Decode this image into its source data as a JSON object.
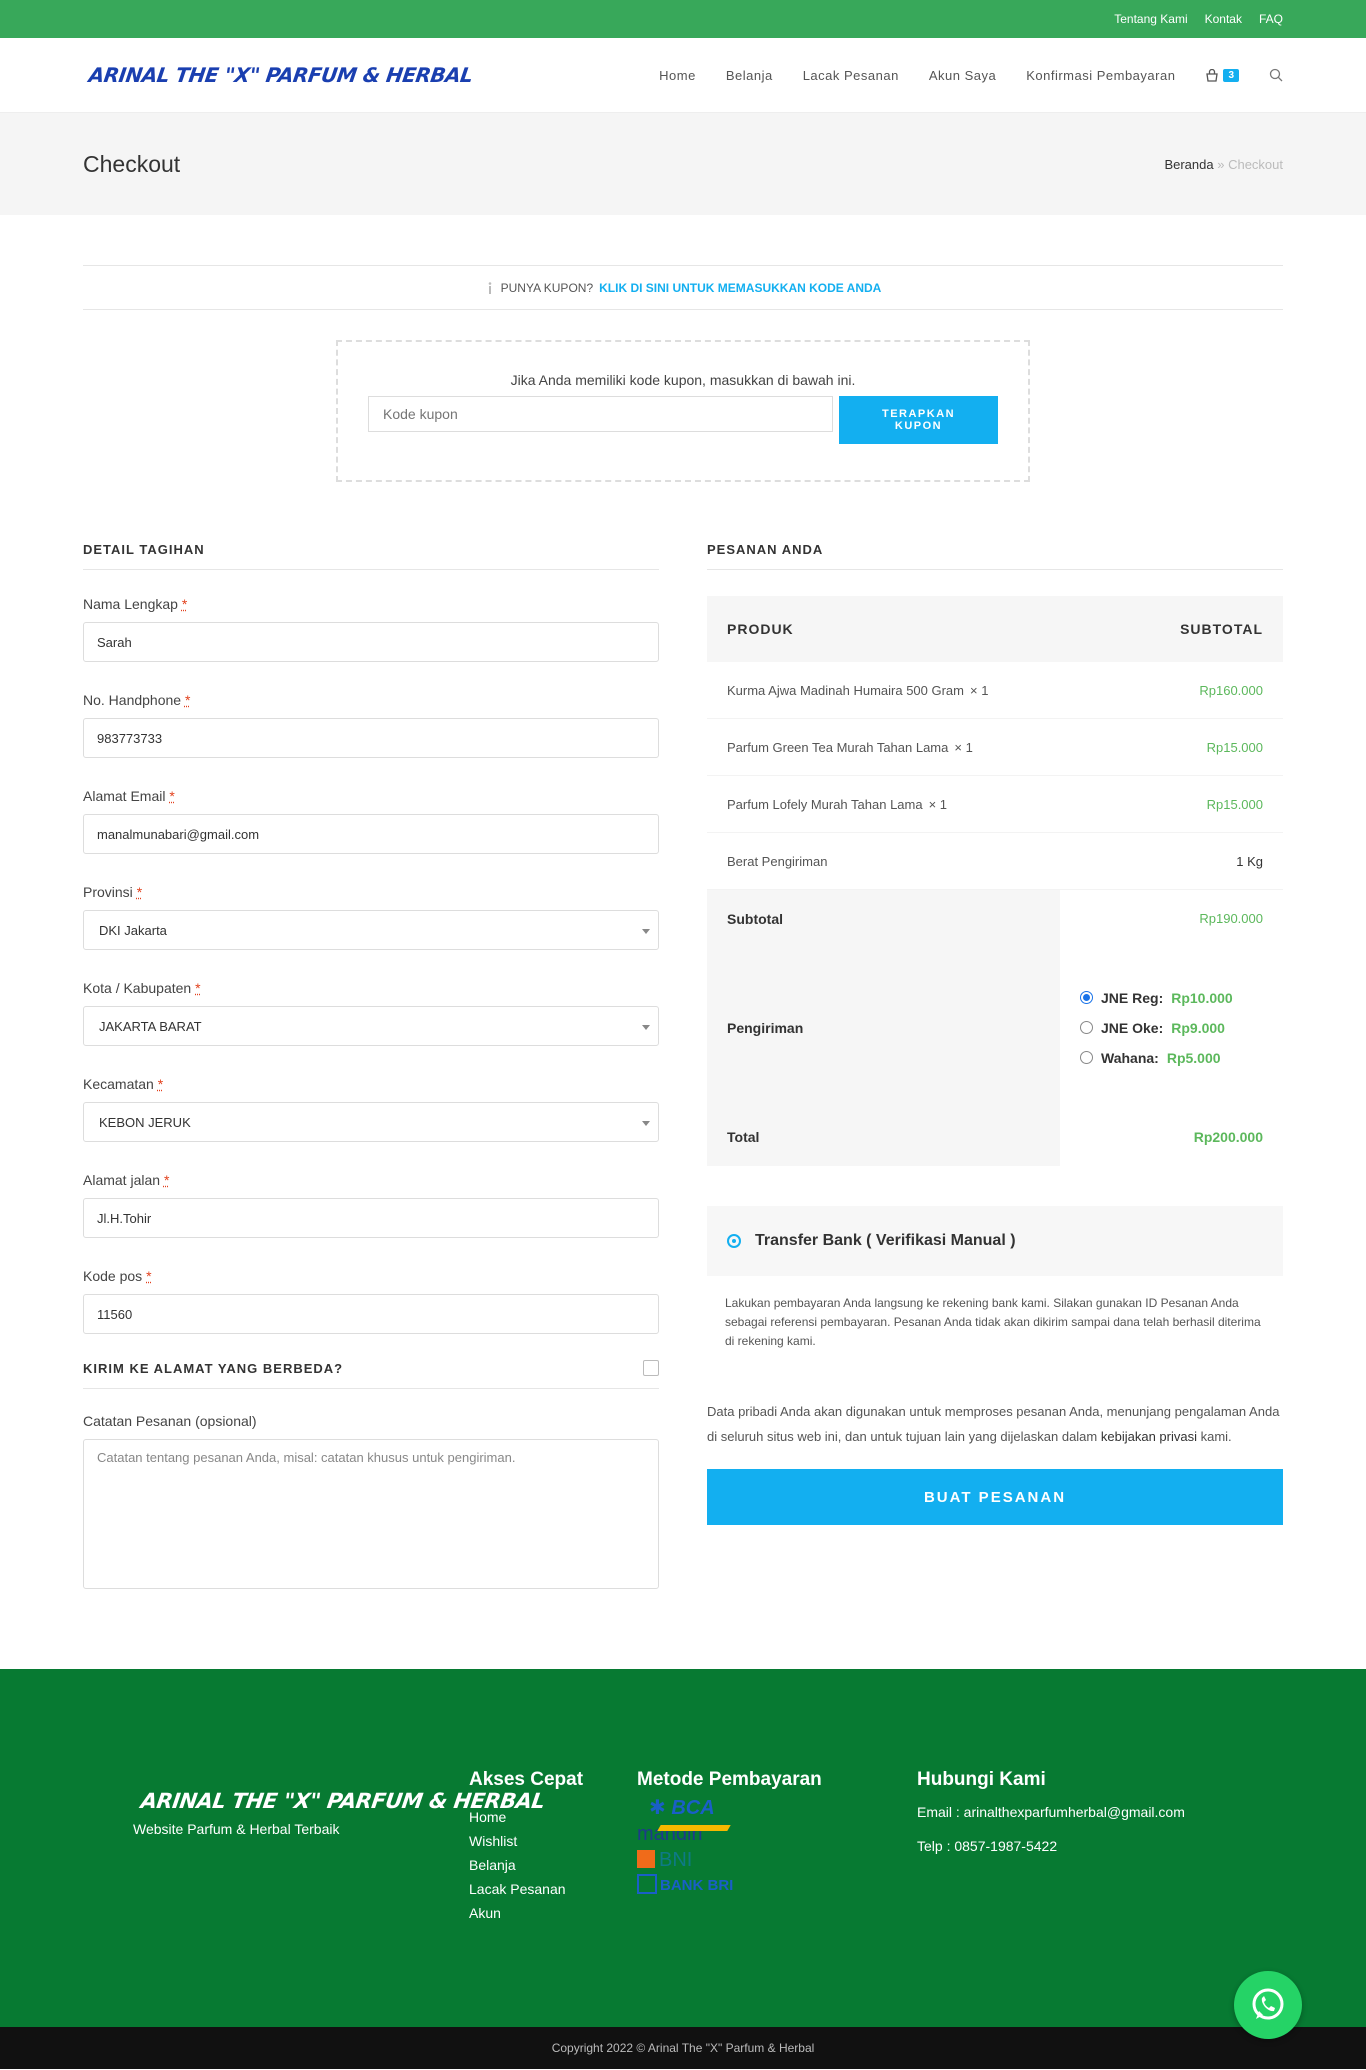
{
  "topbar": {
    "links": [
      "Tentang Kami",
      "Kontak",
      "FAQ"
    ]
  },
  "header": {
    "logo": "ARINAL THE \"X\" PARFUM & HERBAL",
    "nav": [
      "Home",
      "Belanja",
      "Lacak Pesanan",
      "Akun Saya",
      "Konfirmasi Pembayaran"
    ],
    "cart_count": "3"
  },
  "pagehead": {
    "title": "Checkout",
    "crumb_home": "Beranda",
    "crumb_sep": "»",
    "crumb_current": "Checkout"
  },
  "coupon": {
    "bar_text": "PUNYA KUPON?",
    "bar_link": "KLIK DI SINI UNTUK MEMASUKKAN KODE ANDA",
    "box_text": "Jika Anda memiliki kode kupon, masukkan di bawah ini.",
    "placeholder": "Kode kupon",
    "button_line1": "TERAPKAN",
    "button_line2": "KUPON"
  },
  "billing": {
    "title": "DETAIL TAGIHAN",
    "fields": [
      {
        "label": "Nama Lengkap",
        "value": "Sarah"
      },
      {
        "label": "No. Handphone",
        "value": "983773733"
      },
      {
        "label": "Alamat Email",
        "value": "manalmunabari@gmail.com"
      },
      {
        "label": "Provinsi",
        "value": "DKI Jakarta"
      },
      {
        "label": "Kota / Kabupaten",
        "value": "JAKARTA BARAT"
      },
      {
        "label": "Kecamatan",
        "value": "KEBON JERUK"
      },
      {
        "label": "Alamat jalan",
        "value": "Jl.H.Tohir"
      },
      {
        "label": "Kode pos",
        "value": "11560"
      }
    ],
    "required_mark": "*",
    "ship_diff": "KIRIM KE ALAMAT YANG BERBEDA?",
    "notes_label": "Catatan Pesanan (opsional)",
    "notes_placeholder": "Catatan tentang pesanan Anda, misal: catatan khusus untuk pengiriman."
  },
  "order": {
    "title": "PESANAN ANDA",
    "col_product": "PRODUK",
    "col_subtotal": "SUBTOTAL",
    "items": [
      {
        "name": "Kurma Ajwa Madinah Humaira 500 Gram",
        "qty": "× 1",
        "price": "Rp160.000"
      },
      {
        "name": "Parfum Green Tea Murah Tahan Lama",
        "qty": "× 1",
        "price": "Rp15.000"
      },
      {
        "name": "Parfum Lofely Murah Tahan Lama",
        "qty": "× 1",
        "price": "Rp15.000"
      }
    ],
    "weight_label": "Berat Pengiriman",
    "weight_value": "1 Kg",
    "subtotal_label": "Subtotal",
    "subtotal_value": "Rp190.000",
    "shipping_label": "Pengiriman",
    "shipping_options": [
      {
        "name": "JNE Reg:",
        "price": "Rp10.000",
        "selected": true
      },
      {
        "name": "JNE Oke:",
        "price": "Rp9.000",
        "selected": false
      },
      {
        "name": "Wahana:",
        "price": "Rp5.000",
        "selected": false
      }
    ],
    "total_label": "Total",
    "total_value": "Rp200.000"
  },
  "payment": {
    "method": "Transfer Bank ( Verifikasi Manual )",
    "description": "Lakukan pembayaran Anda langsung ke rekening bank kami. Silakan gunakan ID Pesanan Anda sebagai referensi pembayaran. Pesanan Anda tidak akan dikirim sampai dana telah berhasil diterima di rekening kami.",
    "privacy_text": "Data pribadi Anda akan digunakan untuk memproses pesanan Anda, menunjang pengalaman Anda di seluruh situs web ini, dan untuk tujuan lain yang dijelaskan dalam",
    "privacy_link": "kebijakan privasi",
    "privacy_end": "kami.",
    "button": "BUAT PESANAN"
  },
  "footer": {
    "logo": "ARINAL THE \"X\" PARFUM & HERBAL",
    "tagline": "Website Parfum & Herbal Terbaik",
    "quick_title": "Akses Cepat",
    "quick_links": [
      "Home",
      "Wishlist",
      "Belanja",
      "Lacak Pesanan",
      "Akun"
    ],
    "pay_title": "Metode Pembayaran",
    "banks": [
      "BCA",
      "mandiri",
      "BNI",
      "BANK BRI"
    ],
    "contact_title": "Hubungi Kami",
    "email": "Email : arinalthexparfumherbal@gmail.com",
    "phone": "Telp : 0857-1987-5422",
    "copyright": "Copyright 2022 © Arinal The \"X\" Parfum & Herbal"
  },
  "colors": {
    "topbar": "#38a85a",
    "accent": "#13aff0",
    "price": "#5cb85c",
    "footer": "#077a32"
  }
}
